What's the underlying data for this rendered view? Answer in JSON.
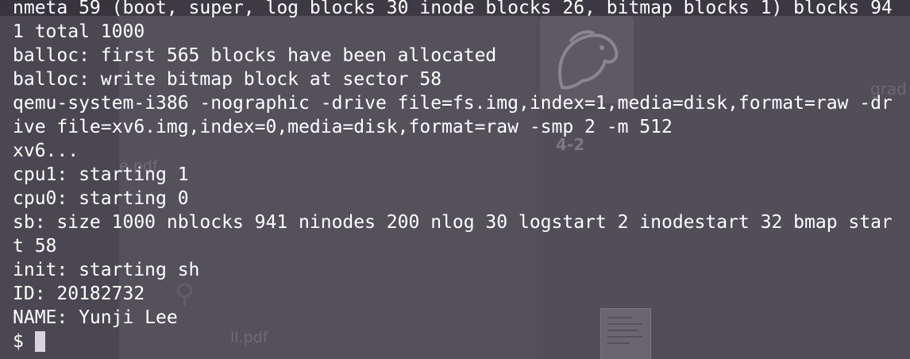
{
  "desktop": {
    "file_label_1": "4-2",
    "file_label_2": "grad",
    "under_label_pdf_1": "e.pdf",
    "under_label_pdf_2": "ll.pdf",
    "icon_names": [
      "horse-icon",
      "search-icon",
      "document-thumbnail-icon"
    ]
  },
  "terminal": {
    "lines": [
      "nmeta 59 (boot, super, log blocks 30 inode blocks 26, bitmap blocks 1) blocks 94",
      "1 total 1000",
      "balloc: first 565 blocks have been allocated",
      "balloc: write bitmap block at sector 58",
      "qemu-system-i386 -nographic -drive file=fs.img,index=1,media=disk,format=raw -dr",
      "ive file=xv6.img,index=0,media=disk,format=raw -smp 2 -m 512",
      "xv6...",
      "cpu1: starting 1",
      "cpu0: starting 0",
      "sb: size 1000 nblocks 941 ninodes 200 nlog 30 logstart 2 inodestart 32 bmap star",
      "t 58",
      "init: starting sh",
      "ID: 20182732",
      "NAME: Yunji Lee"
    ],
    "prompt": "$"
  },
  "colors": {
    "terminal_text": "#ffffff",
    "terminal_background": "#4b4752",
    "cursor": "#d6d4d8"
  }
}
